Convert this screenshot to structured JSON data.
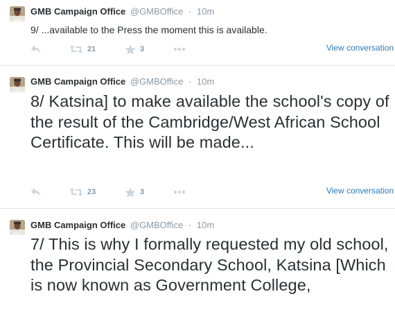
{
  "colors": {
    "link": "#2b7bb9",
    "muted": "#8899a6",
    "icon": "#ccd6dd",
    "text": "#292f33",
    "divider": "#e1e8ed"
  },
  "tweets": [
    {
      "name": "GMB Campaign Office",
      "handle": "@GMBOffice",
      "dot": "·",
      "time": "10m",
      "text": "9/ ...available to the Press the moment this is available.",
      "retweets": "21",
      "favorites": "3",
      "view_conversation": "View conversation",
      "icons": [
        "reply-icon",
        "retweet-icon",
        "favorite-star-icon",
        "more-dots-icon"
      ]
    },
    {
      "name": "GMB Campaign Office",
      "handle": "@GMBOffice",
      "dot": "·",
      "time": "10m",
      "text": "8/ Katsina] to make available the school's copy of the result of the Cambridge/West African School Certificate. This will be made...",
      "retweets": "23",
      "favorites": "3",
      "view_conversation": "View conversation",
      "icons": [
        "reply-icon",
        "retweet-icon",
        "favorite-star-icon",
        "more-dots-icon"
      ]
    },
    {
      "name": "GMB Campaign Office",
      "handle": "@GMBOffice",
      "dot": "·",
      "time": "10m",
      "text": "7/ This is why I formally requested my old school, the Provincial Secondary School, Katsina [Which is now known as Government College,"
    }
  ]
}
